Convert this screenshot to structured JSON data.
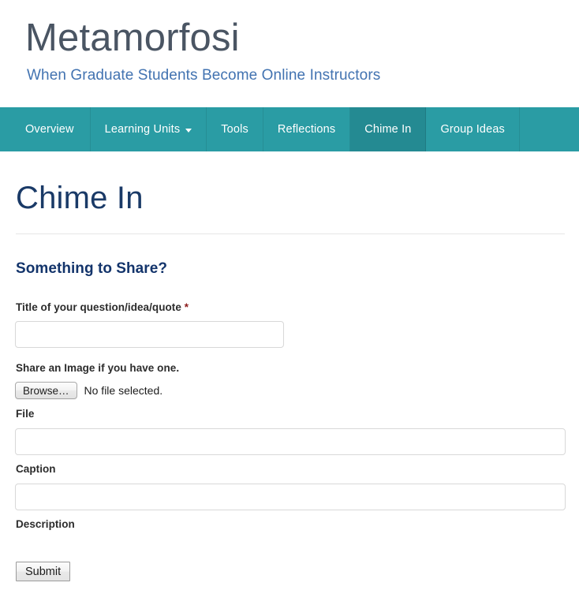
{
  "header": {
    "title": "Metamorfosi",
    "tagline": "When Graduate Students Become Online Instructors",
    "title_color": "#4a5563",
    "tagline_color": "#4273b1"
  },
  "nav": {
    "background_color": "#2a9ca4",
    "active_background_color": "#248a92",
    "items": [
      {
        "label": "Overview",
        "active": false,
        "has_caret": false
      },
      {
        "label": "Learning Units",
        "active": false,
        "has_caret": true,
        "caret_icon": "chevron-down-icon"
      },
      {
        "label": "Tools",
        "active": false,
        "has_caret": false
      },
      {
        "label": "Reflections",
        "active": false,
        "has_caret": false
      },
      {
        "label": "Chime In",
        "active": true,
        "has_caret": false
      },
      {
        "label": "Group Ideas",
        "active": false,
        "has_caret": false
      }
    ]
  },
  "main": {
    "page_title": "Chime In",
    "page_title_color": "#1a3a67",
    "section_heading": "Something to Share?",
    "section_heading_color": "#13346b"
  },
  "form": {
    "title_field": {
      "label": "Title of your question/idea/quote",
      "required_marker": "*",
      "required_marker_color": "#8c1b1b",
      "value": "",
      "placeholder": ""
    },
    "image_section": {
      "label": "Share an Image if you have one.",
      "browse_button_label": "Browse…",
      "file_status": "No file selected."
    },
    "file_field": {
      "label": "File",
      "value": "",
      "placeholder": ""
    },
    "caption_field": {
      "label": "Caption",
      "value": "",
      "placeholder": ""
    },
    "description_field": {
      "label": "Description"
    },
    "submit_button_label": "Submit"
  }
}
